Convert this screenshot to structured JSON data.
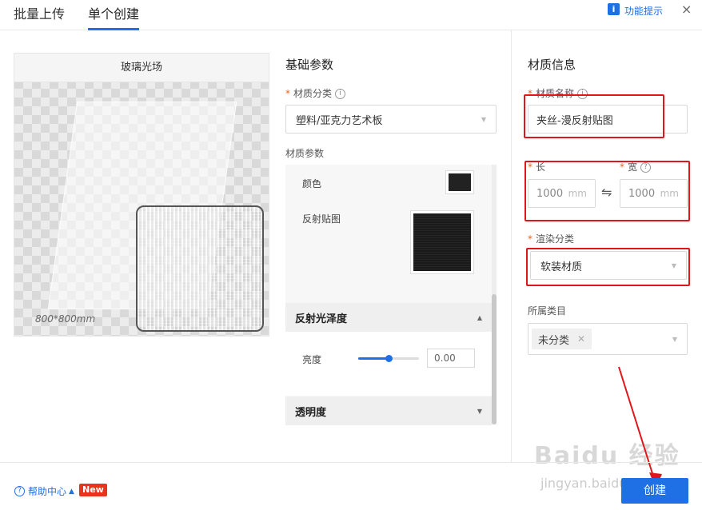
{
  "tabs": [
    {
      "label": "批量上传"
    },
    {
      "label": "单个创建"
    }
  ],
  "header": {
    "hint_label": "功能提示",
    "hint_icon": "i",
    "close_icon": "×"
  },
  "preview": {
    "title": "玻璃光场",
    "caption": "800*800mm"
  },
  "basic": {
    "title": "基础参数",
    "category_label": "材质分类",
    "category_value": "塑料/亚克力艺术板",
    "params_label": "材质参数",
    "color_label": "颜色",
    "reflect_map_label": "反射贴图",
    "gloss_group": "反射光泽度",
    "brightness_label": "亮度",
    "brightness_value": "0.00",
    "opacity_group": "透明度"
  },
  "material": {
    "title": "材质信息",
    "name_label": "材质名称",
    "name_value": "夹丝-漫反射贴图",
    "length_label": "长",
    "length_value": "1000",
    "width_label": "宽",
    "width_value": "1000",
    "unit": "mm",
    "render_label": "渲染分类",
    "render_value": "软装材质",
    "category_label": "所属类目",
    "category_tag": "未分类"
  },
  "footer": {
    "help_label": "帮助中心",
    "new_badge": "New",
    "create_label": "创建"
  },
  "watermark": {
    "main": "Baidu 经验",
    "sub": "jingyan.baidu.com"
  },
  "colors": {
    "accent": "#1f6fe5",
    "annotation": "#e0161b",
    "required": "#e8641b",
    "badge": "#e8341c"
  }
}
